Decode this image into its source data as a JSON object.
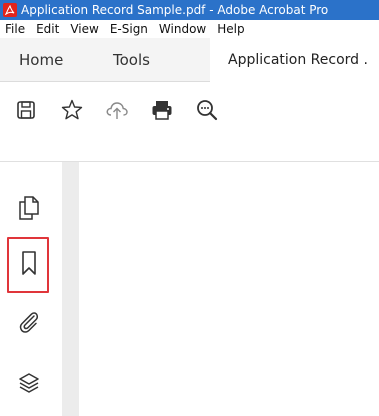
{
  "window": {
    "title": "Application Record Sample.pdf - Adobe Acrobat Pro"
  },
  "menu": {
    "items": [
      "File",
      "Edit",
      "View",
      "E-Sign",
      "Window",
      "Help"
    ]
  },
  "tabs": {
    "home": "Home",
    "tools": "Tools",
    "document": "Application Record ."
  },
  "toolbar": {
    "icons": [
      "save-icon",
      "bookmark-star-icon",
      "cloud-upload-icon",
      "print-icon",
      "zoom-out-icon"
    ]
  },
  "sidebar": {
    "icons": [
      "pages-icon",
      "bookmark-icon",
      "attachment-icon",
      "layers-icon"
    ],
    "highlighted": "bookmark-icon"
  },
  "colors": {
    "titlebar": "#2b72c9",
    "highlight": "#e0353a",
    "tabbar": "#f4f4f4"
  }
}
